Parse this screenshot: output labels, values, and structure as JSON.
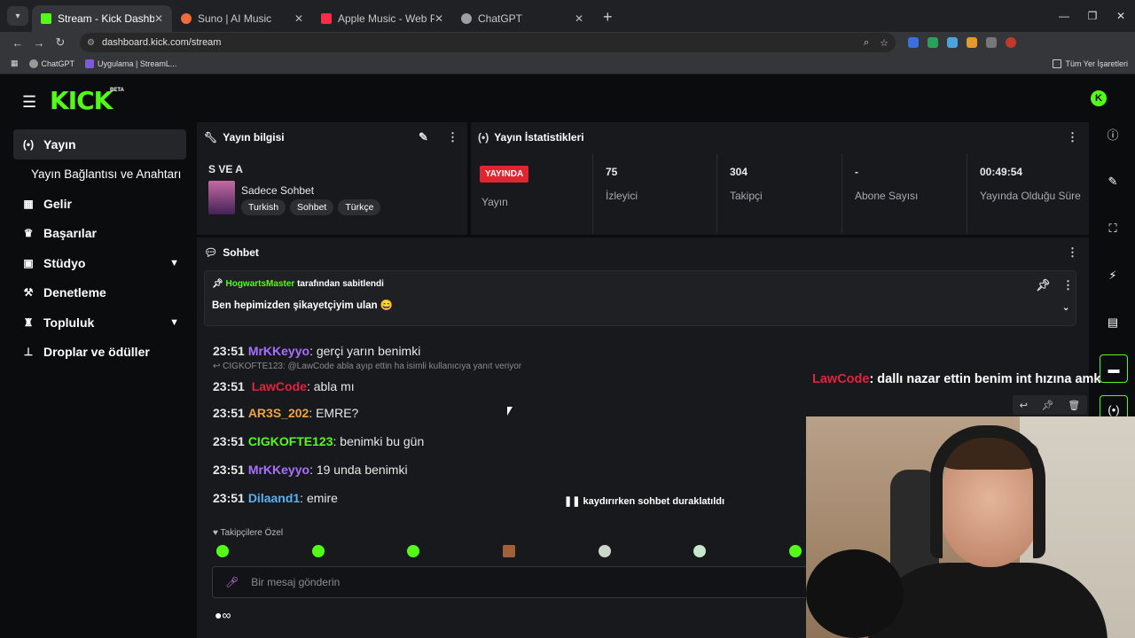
{
  "browser": {
    "tabs": [
      {
        "title": "Stream - Kick Dashboard",
        "color": "#53fc18",
        "active": true
      },
      {
        "title": "Suno | AI Music",
        "color": "#f26b3a",
        "active": false
      },
      {
        "title": "Apple Music - Web Player",
        "color": "#fa2d48",
        "active": false
      },
      {
        "title": "ChatGPT",
        "color": "#9aa0a6",
        "active": false
      }
    ],
    "url": "dashboard.kick.com/stream",
    "bookmarks": [
      "ChatGPT",
      "Uygulama | StreamL...",
      "Tüm Yer İşaretleri"
    ]
  },
  "brand": {
    "logo": "KICK",
    "beta": "BETA",
    "accent": "#53fc18"
  },
  "sidebar": {
    "items": [
      {
        "label": "Yayın",
        "icon": "broadcast-icon",
        "active": true
      },
      {
        "label": "Yayın Bağlantısı ve Anahtarı",
        "sub": true
      },
      {
        "label": "Gelir",
        "icon": "grid-icon"
      },
      {
        "label": "Başarılar",
        "icon": "trophy-icon"
      },
      {
        "label": "Stüdyo",
        "icon": "studio-icon",
        "expand": true
      },
      {
        "label": "Denetleme",
        "icon": "hammer-icon"
      },
      {
        "label": "Topluluk",
        "icon": "community-icon",
        "expand": true
      },
      {
        "label": "Droplar ve ödüller",
        "icon": "drops-icon"
      }
    ]
  },
  "stream_info": {
    "title": "Yayın bilgisi",
    "stream_title": "S VE A",
    "category": "Sadece Sohbet",
    "tags": [
      "Turkish",
      "Sohbet",
      "Türkçe"
    ]
  },
  "stats": {
    "title": "Yayın İstatistikleri",
    "live_badge": "YAYINDA",
    "live_label": "Yayın",
    "items": [
      {
        "value": "75",
        "label": "İzleyici"
      },
      {
        "value": "304",
        "label": "Takipçi"
      },
      {
        "value": "-",
        "label": "Abone Sayısı"
      },
      {
        "value": "00:49:54",
        "label": "Yayında Olduğu Süre"
      }
    ]
  },
  "chat": {
    "title": "Sohbet",
    "pinned": {
      "user": "HogwartsMaster",
      "by_text": "tarafından sabitlendi",
      "message": "Ben hepimizden şikayetçiyim ulan 😄"
    },
    "messages": [
      {
        "time": "23:51",
        "user": "MrKKeyyo",
        "color": "#a970ff",
        "text": "gerçi yarın benimki"
      },
      {
        "reply": "CIGKOFTE123: @LawCode abla ayıp ettin ha isimli kullanıcıya yanıt veriyor"
      },
      {
        "time": "23:51",
        "user": "LawCode",
        "color": "#e0243e",
        "text": "abla mı"
      },
      {
        "time": "23:51",
        "user": "AR3S_202",
        "color": "#f0a340",
        "text": "EMRE?"
      },
      {
        "time": "23:51",
        "user": "CIGKOFTE123",
        "color": "#53fc18",
        "text": "benimki bu gün"
      },
      {
        "time": "23:51",
        "user": "MrKKeyyo",
        "color": "#a970ff",
        "text": "19 unda benimki"
      },
      {
        "time": "23:51",
        "user": "Dilaand1",
        "color": "#5ab0f0",
        "text": "emire"
      }
    ],
    "paused": "kaydırırken sohbet duraklatıldı",
    "followers_only": "Takipçilere Özel",
    "input_placeholder": "Bir mesaj gönderin"
  },
  "overlay": {
    "user": "LawCode",
    "text": ": dallı nazar ettin benim int hızına amk"
  }
}
